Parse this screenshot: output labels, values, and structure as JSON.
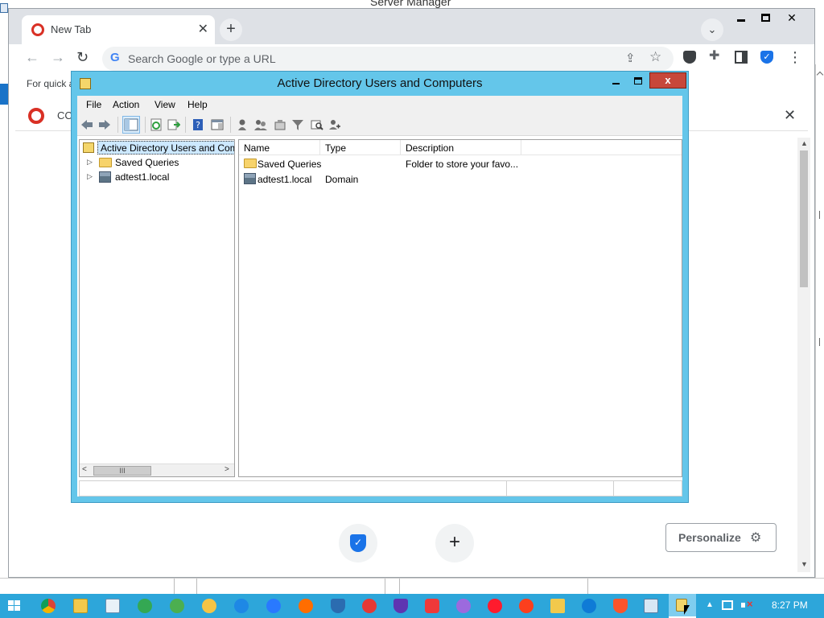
{
  "server_manager": {
    "title": "Server Manager"
  },
  "chrome": {
    "tab_title": "New Tab",
    "tab_close": "✕",
    "newtab_plus": "+",
    "omnibox_placeholder": "Search Google or type a URL",
    "bookmarks_hint": "For quick a",
    "ccleaner_bar_text": "CC",
    "menu_dots": "⋮",
    "personalize_label": "Personalize"
  },
  "aduc": {
    "title": "Active Directory Users and Computers",
    "close_glyph": "x",
    "menu": {
      "file": "File",
      "action": "Action",
      "view": "View",
      "help": "Help"
    },
    "tree": {
      "root": "Active Directory Users and Com",
      "items": [
        {
          "label": "Saved Queries"
        },
        {
          "label": "adtest1.local"
        }
      ],
      "hscroll_thumb": "III"
    },
    "list": {
      "columns": [
        "Name",
        "Type",
        "Description"
      ],
      "rows": [
        {
          "name": "Saved Queries",
          "type": "",
          "description": "Folder to store your favo..."
        },
        {
          "name": "adtest1.local",
          "type": "Domain",
          "description": ""
        }
      ]
    }
  },
  "taskbar": {
    "clock": "8:27 PM"
  },
  "colors": {
    "taskbar": "#2da6da",
    "aduc_frame": "#64c6ea",
    "close_button": "#c7473a",
    "selection": "#cce8ff"
  }
}
